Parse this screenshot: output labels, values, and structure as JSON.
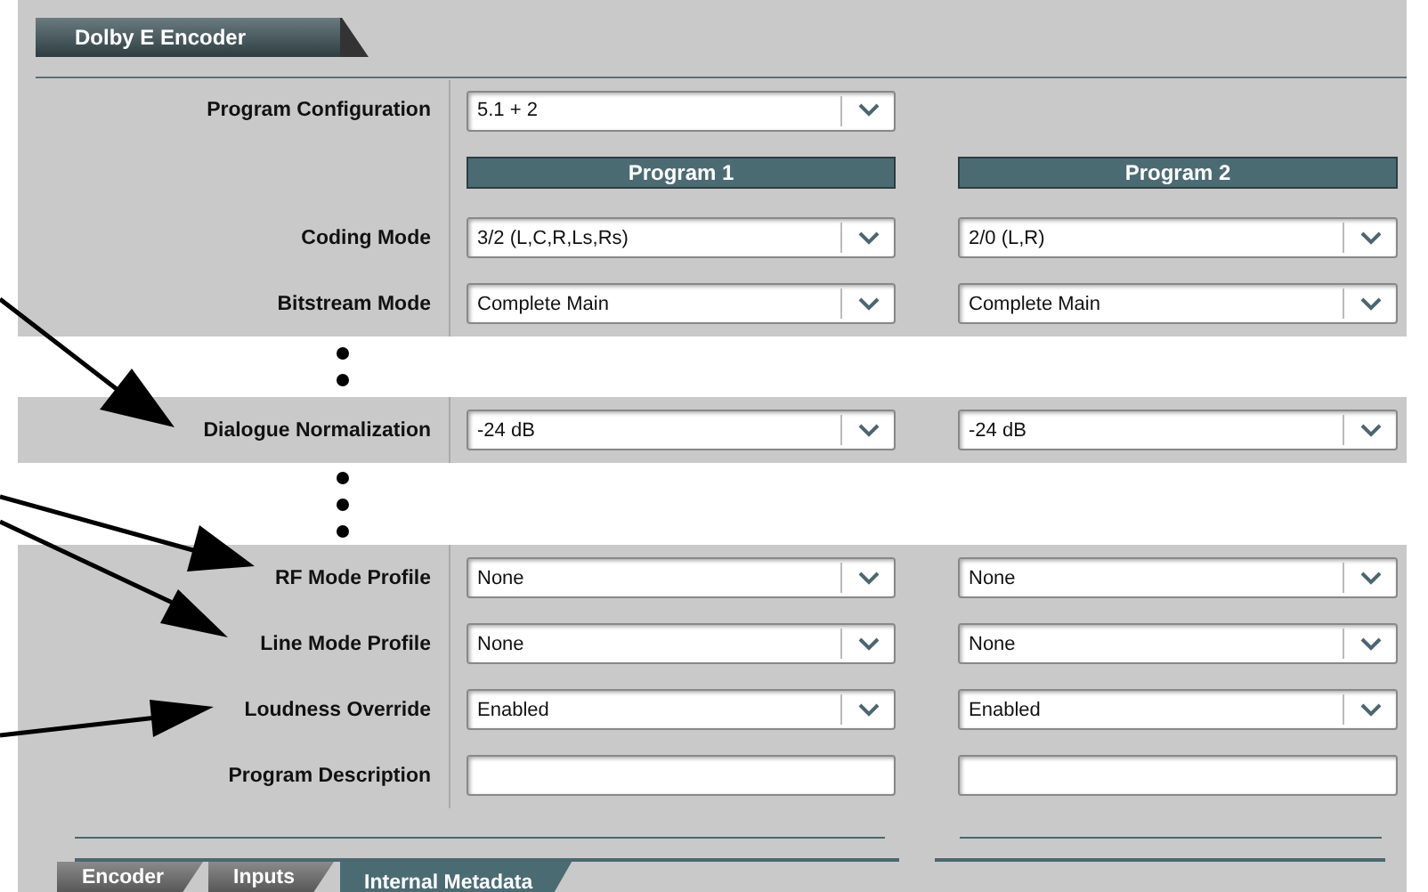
{
  "panel_title": "Dolby E Encoder",
  "program_configuration": {
    "label": "Program Configuration",
    "value": "5.1 + 2"
  },
  "programs": [
    "Program 1",
    "Program 2"
  ],
  "rows": [
    {
      "kind": "dropdown",
      "label": "Coding Mode",
      "values": [
        "3/2 (L,C,R,Ls,Rs)",
        "2/0 (L,R)"
      ]
    },
    {
      "kind": "dropdown",
      "label": "Bitstream Mode",
      "values": [
        "Complete Main",
        "Complete Main"
      ]
    },
    {
      "kind": "gap"
    },
    {
      "kind": "dropdown",
      "label": "Dialogue Normalization",
      "values": [
        "-24 dB",
        "-24 dB"
      ]
    },
    {
      "kind": "break"
    },
    {
      "kind": "dropdown",
      "label": "RF Mode Profile",
      "values": [
        "None",
        "None"
      ]
    },
    {
      "kind": "dropdown",
      "label": "Line Mode Profile",
      "values": [
        "None",
        "None"
      ]
    },
    {
      "kind": "dropdown",
      "label": "Loudness Override",
      "values": [
        "Enabled",
        "Enabled"
      ]
    },
    {
      "kind": "text",
      "label": "Program Description"
    }
  ],
  "tabs": [
    {
      "label": "Encoder",
      "selected": false
    },
    {
      "label": "Inputs",
      "selected": false
    },
    {
      "label": "Internal Metadata",
      "selected": true
    }
  ]
}
